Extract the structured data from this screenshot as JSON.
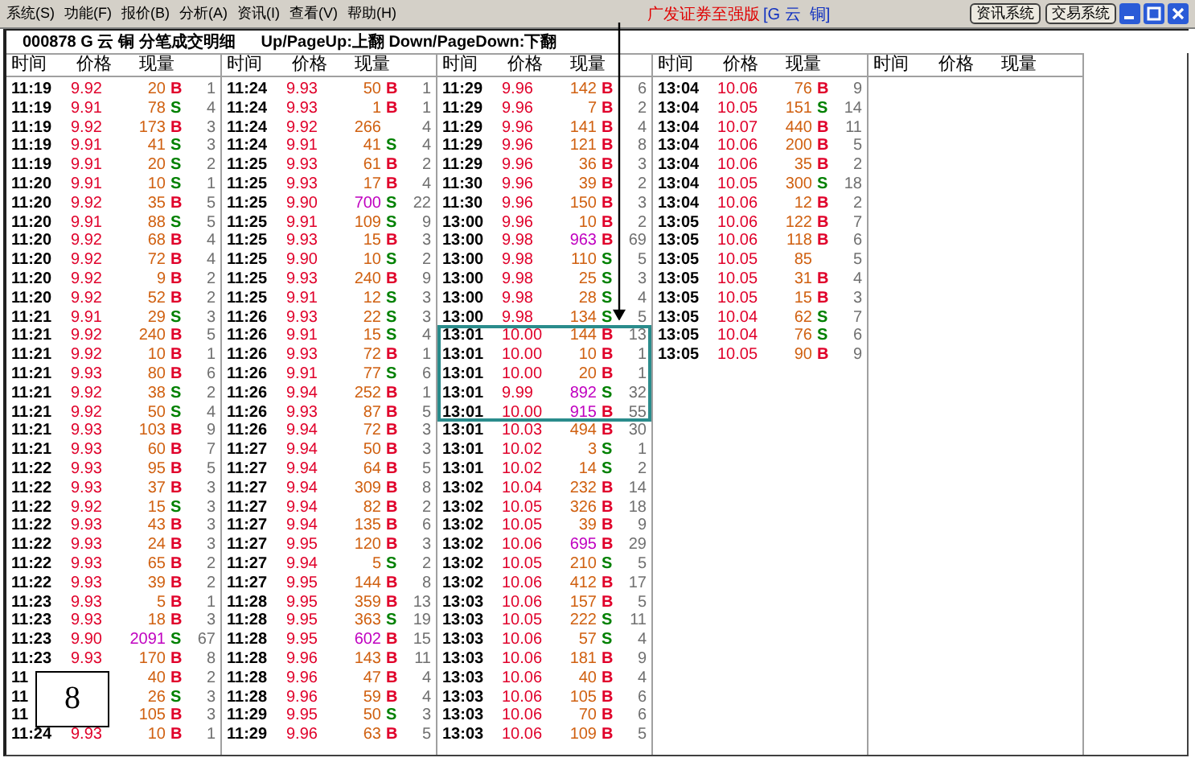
{
  "menu": [
    "系统(S)",
    "功能(F)",
    "报价(B)",
    "分析(A)",
    "资讯(I)",
    "查看(V)",
    "帮助(H)"
  ],
  "app_title": "广发证券至强版",
  "security_tag": "[G 云  铜]",
  "header_buttons": [
    "资讯系统",
    "交易系统"
  ],
  "title_line": "000878 G 云 铜 分笔成交明细",
  "hint": "Up/PageUp:上翻 Down/PageDown:下翻",
  "marker_label": "8",
  "groups": [
    {
      "columns": [
        "时间",
        "价格",
        "现量"
      ],
      "rows": [
        {
          "time": "11:19",
          "price": "9.92",
          "volume": "20",
          "side": "B",
          "count": "1",
          "large": false
        },
        {
          "time": "11:19",
          "price": "9.91",
          "volume": "78",
          "side": "S",
          "count": "4",
          "large": false
        },
        {
          "time": "11:19",
          "price": "9.92",
          "volume": "173",
          "side": "B",
          "count": "3",
          "large": false
        },
        {
          "time": "11:19",
          "price": "9.91",
          "volume": "41",
          "side": "S",
          "count": "3",
          "large": false
        },
        {
          "time": "11:19",
          "price": "9.91",
          "volume": "20",
          "side": "S",
          "count": "2",
          "large": false
        },
        {
          "time": "11:20",
          "price": "9.91",
          "volume": "10",
          "side": "S",
          "count": "1",
          "large": false
        },
        {
          "time": "11:20",
          "price": "9.92",
          "volume": "35",
          "side": "B",
          "count": "5",
          "large": false
        },
        {
          "time": "11:20",
          "price": "9.91",
          "volume": "88",
          "side": "S",
          "count": "5",
          "large": false
        },
        {
          "time": "11:20",
          "price": "9.92",
          "volume": "68",
          "side": "B",
          "count": "4",
          "large": false
        },
        {
          "time": "11:20",
          "price": "9.92",
          "volume": "72",
          "side": "B",
          "count": "4",
          "large": false
        },
        {
          "time": "11:20",
          "price": "9.92",
          "volume": "9",
          "side": "B",
          "count": "2",
          "large": false
        },
        {
          "time": "11:20",
          "price": "9.92",
          "volume": "52",
          "side": "B",
          "count": "2",
          "large": false
        },
        {
          "time": "11:21",
          "price": "9.91",
          "volume": "29",
          "side": "S",
          "count": "3",
          "large": false
        },
        {
          "time": "11:21",
          "price": "9.92",
          "volume": "240",
          "side": "B",
          "count": "5",
          "large": false
        },
        {
          "time": "11:21",
          "price": "9.92",
          "volume": "10",
          "side": "B",
          "count": "1",
          "large": false
        },
        {
          "time": "11:21",
          "price": "9.93",
          "volume": "80",
          "side": "B",
          "count": "6",
          "large": false
        },
        {
          "time": "11:21",
          "price": "9.92",
          "volume": "38",
          "side": "S",
          "count": "2",
          "large": false
        },
        {
          "time": "11:21",
          "price": "9.92",
          "volume": "50",
          "side": "S",
          "count": "4",
          "large": false
        },
        {
          "time": "11:21",
          "price": "9.93",
          "volume": "103",
          "side": "B",
          "count": "9",
          "large": false
        },
        {
          "time": "11:21",
          "price": "9.93",
          "volume": "60",
          "side": "B",
          "count": "7",
          "large": false
        },
        {
          "time": "11:22",
          "price": "9.93",
          "volume": "95",
          "side": "B",
          "count": "5",
          "large": false
        },
        {
          "time": "11:22",
          "price": "9.93",
          "volume": "37",
          "side": "B",
          "count": "3",
          "large": false
        },
        {
          "time": "11:22",
          "price": "9.92",
          "volume": "15",
          "side": "S",
          "count": "3",
          "large": false
        },
        {
          "time": "11:22",
          "price": "9.93",
          "volume": "43",
          "side": "B",
          "count": "3",
          "large": false
        },
        {
          "time": "11:22",
          "price": "9.93",
          "volume": "24",
          "side": "B",
          "count": "3",
          "large": false
        },
        {
          "time": "11:22",
          "price": "9.93",
          "volume": "65",
          "side": "B",
          "count": "2",
          "large": false
        },
        {
          "time": "11:22",
          "price": "9.93",
          "volume": "39",
          "side": "B",
          "count": "2",
          "large": false
        },
        {
          "time": "11:23",
          "price": "9.93",
          "volume": "5",
          "side": "B",
          "count": "1",
          "large": false
        },
        {
          "time": "11:23",
          "price": "9.93",
          "volume": "18",
          "side": "B",
          "count": "3",
          "large": false
        },
        {
          "time": "11:23",
          "price": "9.90",
          "volume": "2091",
          "side": "S",
          "count": "67",
          "large": true
        },
        {
          "time": "11:23",
          "price": "9.93",
          "volume": "170",
          "side": "B",
          "count": "8",
          "large": false
        },
        {
          "time": "11",
          "volume": "40",
          "side": "B",
          "count": "2",
          "large": false
        },
        {
          "time": "11",
          "volume": "26",
          "side": "S",
          "count": "3",
          "large": false
        },
        {
          "time": "11",
          "volume": "105",
          "side": "B",
          "count": "3",
          "large": false
        },
        {
          "time": "11:24",
          "price": "9.93",
          "volume": "10",
          "side": "B",
          "count": "1",
          "large": false
        }
      ]
    },
    {
      "columns": [
        "时间",
        "价格",
        "现量"
      ],
      "rows": [
        {
          "time": "11:24",
          "price": "9.93",
          "volume": "50",
          "side": "B",
          "count": "1",
          "large": false
        },
        {
          "time": "11:24",
          "price": "9.93",
          "volume": "1",
          "side": "B",
          "count": "1",
          "large": false
        },
        {
          "time": "11:24",
          "price": "9.92",
          "volume": "266",
          "count": "4",
          "large": false
        },
        {
          "time": "11:24",
          "price": "9.91",
          "volume": "41",
          "side": "S",
          "count": "4",
          "large": false
        },
        {
          "time": "11:25",
          "price": "9.93",
          "volume": "61",
          "side": "B",
          "count": "2",
          "large": false
        },
        {
          "time": "11:25",
          "price": "9.93",
          "volume": "17",
          "side": "B",
          "count": "4",
          "large": false
        },
        {
          "time": "11:25",
          "price": "9.90",
          "volume": "700",
          "side": "S",
          "count": "22",
          "large": true
        },
        {
          "time": "11:25",
          "price": "9.91",
          "volume": "109",
          "side": "S",
          "count": "9",
          "large": false
        },
        {
          "time": "11:25",
          "price": "9.93",
          "volume": "15",
          "side": "B",
          "count": "3",
          "large": false
        },
        {
          "time": "11:25",
          "price": "9.90",
          "volume": "10",
          "side": "S",
          "count": "2",
          "large": false
        },
        {
          "time": "11:25",
          "price": "9.93",
          "volume": "240",
          "side": "B",
          "count": "9",
          "large": false
        },
        {
          "time": "11:25",
          "price": "9.91",
          "volume": "12",
          "side": "S",
          "count": "3",
          "large": false
        },
        {
          "time": "11:26",
          "price": "9.93",
          "volume": "22",
          "side": "S",
          "count": "3",
          "large": false
        },
        {
          "time": "11:26",
          "price": "9.91",
          "volume": "15",
          "side": "S",
          "count": "4",
          "large": false
        },
        {
          "time": "11:26",
          "price": "9.93",
          "volume": "72",
          "side": "B",
          "count": "1",
          "large": false
        },
        {
          "time": "11:26",
          "price": "9.91",
          "volume": "77",
          "side": "S",
          "count": "6",
          "large": false
        },
        {
          "time": "11:26",
          "price": "9.94",
          "volume": "252",
          "side": "B",
          "count": "1",
          "large": false
        },
        {
          "time": "11:26",
          "price": "9.93",
          "volume": "87",
          "side": "B",
          "count": "5",
          "large": false
        },
        {
          "time": "11:26",
          "price": "9.94",
          "volume": "72",
          "side": "B",
          "count": "3",
          "large": false
        },
        {
          "time": "11:27",
          "price": "9.94",
          "volume": "50",
          "side": "B",
          "count": "3",
          "large": false
        },
        {
          "time": "11:27",
          "price": "9.94",
          "volume": "64",
          "side": "B",
          "count": "5",
          "large": false
        },
        {
          "time": "11:27",
          "price": "9.94",
          "volume": "309",
          "side": "B",
          "count": "8",
          "large": false
        },
        {
          "time": "11:27",
          "price": "9.94",
          "volume": "82",
          "side": "B",
          "count": "2",
          "large": false
        },
        {
          "time": "11:27",
          "price": "9.94",
          "volume": "135",
          "side": "B",
          "count": "6",
          "large": false
        },
        {
          "time": "11:27",
          "price": "9.95",
          "volume": "120",
          "side": "B",
          "count": "3",
          "large": false
        },
        {
          "time": "11:27",
          "price": "9.94",
          "volume": "5",
          "side": "S",
          "count": "2",
          "large": false
        },
        {
          "time": "11:27",
          "price": "9.95",
          "volume": "144",
          "side": "B",
          "count": "8",
          "large": false
        },
        {
          "time": "11:28",
          "price": "9.95",
          "volume": "359",
          "side": "B",
          "count": "13",
          "large": false
        },
        {
          "time": "11:28",
          "price": "9.95",
          "volume": "363",
          "side": "S",
          "count": "19",
          "large": false
        },
        {
          "time": "11:28",
          "price": "9.95",
          "volume": "602",
          "side": "B",
          "count": "15",
          "large": true
        },
        {
          "time": "11:28",
          "price": "9.96",
          "volume": "143",
          "side": "B",
          "count": "11",
          "large": false
        },
        {
          "time": "11:28",
          "price": "9.96",
          "volume": "47",
          "side": "B",
          "count": "4",
          "large": false
        },
        {
          "time": "11:28",
          "price": "9.96",
          "volume": "59",
          "side": "B",
          "count": "4",
          "large": false
        },
        {
          "time": "11:29",
          "price": "9.95",
          "volume": "50",
          "side": "S",
          "count": "3",
          "large": false
        },
        {
          "time": "11:29",
          "price": "9.96",
          "volume": "63",
          "side": "B",
          "count": "5",
          "large": false
        }
      ]
    },
    {
      "columns": [
        "时间",
        "价格",
        "现量"
      ],
      "rows": [
        {
          "time": "11:29",
          "price": "9.96",
          "volume": "142",
          "side": "B",
          "count": "6",
          "large": false,
          "boxed": false
        },
        {
          "time": "11:29",
          "price": "9.96",
          "volume": "7",
          "side": "B",
          "count": "2",
          "large": false,
          "boxed": false
        },
        {
          "time": "11:29",
          "price": "9.96",
          "volume": "141",
          "side": "B",
          "count": "4",
          "large": false,
          "boxed": false
        },
        {
          "time": "11:29",
          "price": "9.96",
          "volume": "121",
          "side": "B",
          "count": "8",
          "large": false,
          "boxed": false
        },
        {
          "time": "11:29",
          "price": "9.96",
          "volume": "36",
          "side": "B",
          "count": "3",
          "large": false,
          "boxed": false
        },
        {
          "time": "11:30",
          "price": "9.96",
          "volume": "39",
          "side": "B",
          "count": "2",
          "large": false,
          "boxed": false
        },
        {
          "time": "11:30",
          "price": "9.96",
          "volume": "150",
          "side": "B",
          "count": "3",
          "large": false,
          "boxed": false
        },
        {
          "time": "13:00",
          "price": "9.96",
          "volume": "10",
          "side": "B",
          "count": "2",
          "large": false,
          "boxed": false
        },
        {
          "time": "13:00",
          "price": "9.98",
          "volume": "963",
          "side": "B",
          "count": "69",
          "large": true,
          "boxed": false
        },
        {
          "time": "13:00",
          "price": "9.98",
          "volume": "110",
          "side": "S",
          "count": "5",
          "large": false,
          "boxed": false
        },
        {
          "time": "13:00",
          "price": "9.98",
          "volume": "25",
          "side": "S",
          "count": "3",
          "large": false,
          "boxed": false
        },
        {
          "time": "13:00",
          "price": "9.98",
          "volume": "28",
          "side": "S",
          "count": "4",
          "large": false,
          "boxed": false
        },
        {
          "time": "13:00",
          "price": "9.98",
          "volume": "134",
          "side": "S",
          "count": "5",
          "large": false,
          "boxed": false
        },
        {
          "time": "13:01",
          "price": "10.00",
          "volume": "144",
          "side": "B",
          "count": "13",
          "large": false,
          "boxed": true
        },
        {
          "time": "13:01",
          "price": "10.00",
          "volume": "10",
          "side": "B",
          "count": "1",
          "large": false,
          "boxed": true
        },
        {
          "time": "13:01",
          "price": "10.00",
          "volume": "20",
          "side": "B",
          "count": "1",
          "large": false,
          "boxed": true
        },
        {
          "time": "13:01",
          "price": "9.99",
          "volume": "892",
          "side": "S",
          "count": "32",
          "large": true,
          "boxed": true
        },
        {
          "time": "13:01",
          "price": "10.00",
          "volume": "915",
          "side": "B",
          "count": "55",
          "large": true,
          "boxed": true
        },
        {
          "time": "13:01",
          "price": "10.03",
          "volume": "494",
          "side": "B",
          "count": "30",
          "large": false,
          "boxed": false
        },
        {
          "time": "13:01",
          "price": "10.02",
          "volume": "3",
          "side": "S",
          "count": "1",
          "large": false,
          "boxed": false
        },
        {
          "time": "13:01",
          "price": "10.02",
          "volume": "14",
          "side": "S",
          "count": "2",
          "large": false,
          "boxed": false
        },
        {
          "time": "13:02",
          "price": "10.04",
          "volume": "232",
          "side": "B",
          "count": "14",
          "large": false,
          "boxed": false
        },
        {
          "time": "13:02",
          "price": "10.05",
          "volume": "326",
          "side": "B",
          "count": "18",
          "large": false,
          "boxed": false
        },
        {
          "time": "13:02",
          "price": "10.05",
          "volume": "39",
          "side": "B",
          "count": "9",
          "large": false,
          "boxed": false
        },
        {
          "time": "13:02",
          "price": "10.06",
          "volume": "695",
          "side": "B",
          "count": "29",
          "large": true,
          "boxed": false
        },
        {
          "time": "13:02",
          "price": "10.05",
          "volume": "210",
          "side": "S",
          "count": "5",
          "large": false,
          "boxed": false
        },
        {
          "time": "13:02",
          "price": "10.06",
          "volume": "412",
          "side": "B",
          "count": "17",
          "large": false,
          "boxed": false
        },
        {
          "time": "13:03",
          "price": "10.06",
          "volume": "157",
          "side": "B",
          "count": "5",
          "large": false,
          "boxed": false
        },
        {
          "time": "13:03",
          "price": "10.05",
          "volume": "222",
          "side": "S",
          "count": "11",
          "large": false,
          "boxed": false
        },
        {
          "time": "13:03",
          "price": "10.06",
          "volume": "57",
          "side": "S",
          "count": "4",
          "large": false,
          "boxed": false
        },
        {
          "time": "13:03",
          "price": "10.06",
          "volume": "181",
          "side": "B",
          "count": "9",
          "large": false,
          "boxed": false
        },
        {
          "time": "13:03",
          "price": "10.06",
          "volume": "40",
          "side": "B",
          "count": "4",
          "large": false,
          "boxed": false
        },
        {
          "time": "13:03",
          "price": "10.06",
          "volume": "105",
          "side": "B",
          "count": "6",
          "large": false,
          "boxed": false
        },
        {
          "time": "13:03",
          "price": "10.06",
          "volume": "70",
          "side": "B",
          "count": "6",
          "large": false,
          "boxed": false
        },
        {
          "time": "13:03",
          "price": "10.06",
          "volume": "109",
          "side": "B",
          "count": "5",
          "large": false,
          "boxed": false
        }
      ]
    },
    {
      "columns": [
        "时间",
        "价格",
        "现量"
      ],
      "rows": [
        {
          "time": "13:04",
          "price": "10.06",
          "volume": "76",
          "side": "B",
          "count": "9",
          "large": false
        },
        {
          "time": "13:04",
          "price": "10.05",
          "volume": "151",
          "side": "S",
          "count": "14",
          "large": false
        },
        {
          "time": "13:04",
          "price": "10.07",
          "volume": "440",
          "side": "B",
          "count": "11",
          "large": false
        },
        {
          "time": "13:04",
          "price": "10.06",
          "volume": "200",
          "side": "B",
          "count": "5",
          "large": false
        },
        {
          "time": "13:04",
          "price": "10.06",
          "volume": "35",
          "side": "B",
          "count": "2",
          "large": false
        },
        {
          "time": "13:04",
          "price": "10.05",
          "volume": "300",
          "side": "S",
          "count": "18",
          "large": false
        },
        {
          "time": "13:04",
          "price": "10.06",
          "volume": "12",
          "side": "B",
          "count": "2",
          "large": false
        },
        {
          "time": "13:05",
          "price": "10.06",
          "volume": "122",
          "side": "B",
          "count": "7",
          "large": false
        },
        {
          "time": "13:05",
          "price": "10.06",
          "volume": "118",
          "side": "B",
          "count": "6",
          "large": false
        },
        {
          "time": "13:05",
          "price": "10.05",
          "volume": "85",
          "count": "5",
          "large": false
        },
        {
          "time": "13:05",
          "price": "10.05",
          "volume": "31",
          "side": "B",
          "count": "4",
          "large": false
        },
        {
          "time": "13:05",
          "price": "10.05",
          "volume": "15",
          "side": "B",
          "count": "3",
          "large": false
        },
        {
          "time": "13:05",
          "price": "10.04",
          "volume": "62",
          "side": "S",
          "count": "7",
          "large": false
        },
        {
          "time": "13:05",
          "price": "10.04",
          "volume": "76",
          "side": "S",
          "count": "6",
          "large": false
        },
        {
          "time": "13:05",
          "price": "10.05",
          "volume": "90",
          "side": "B",
          "count": "9",
          "large": false
        }
      ]
    },
    {
      "columns": [
        "时间",
        "价格",
        "现量"
      ]
    }
  ]
}
